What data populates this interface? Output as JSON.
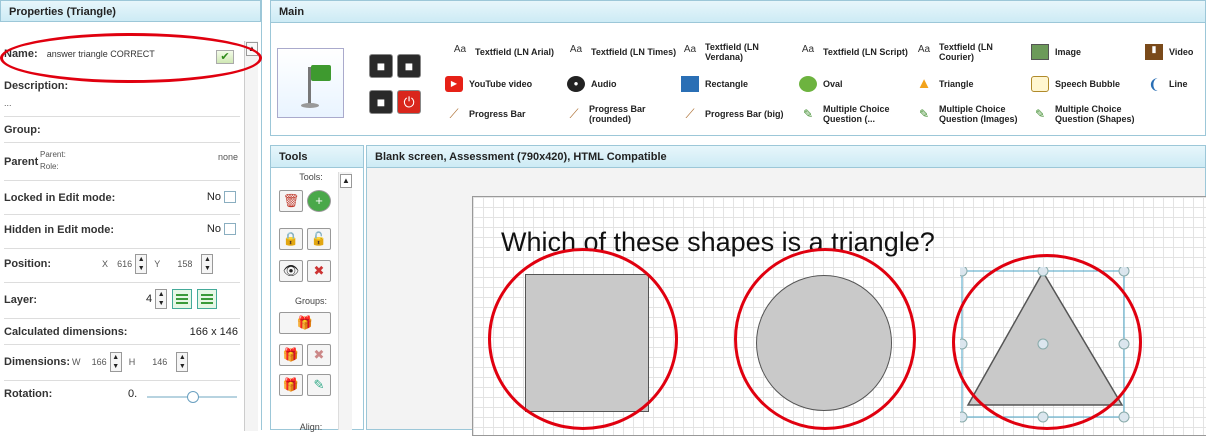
{
  "properties": {
    "title": "Properties (Triangle)",
    "name_label": "Name:",
    "name_value": "answer triangle CORRECT",
    "description_label": "Description:",
    "description_value": "...",
    "group_label": "Group:",
    "parent_label": "Parent",
    "parent_sub1": "Parent:",
    "parent_sub2": "Role:",
    "parent_value": "none",
    "locked_label": "Locked in Edit mode:",
    "locked_value": "No",
    "hidden_label": "Hidden in Edit mode:",
    "hidden_value": "No",
    "position_label": "Position:",
    "x_label": "X",
    "x_value": "616",
    "y_label": "Y",
    "y_value": "158",
    "layer_label": "Layer:",
    "layer_value": "4",
    "calc_dim_label": "Calculated dimensions:",
    "calc_dim_value": "166 x 146",
    "dimensions_label": "Dimensions:",
    "w_label": "W",
    "w_value": "166",
    "h_label": "H",
    "h_value": "146",
    "rotation_label": "Rotation:",
    "rotation_value": "0."
  },
  "main": {
    "title": "Main",
    "tools": [
      {
        "icon": "Aa",
        "label": "Textfield (LN Arial)"
      },
      {
        "icon": "Aa",
        "label": "Textfield (LN Times)"
      },
      {
        "icon": "Aa",
        "label": "Textfield (LN Verdana)"
      },
      {
        "icon": "Aa",
        "label": "Textfield (LN Script)"
      },
      {
        "icon": "Aa",
        "label": "Textfield (LN Courier)"
      },
      {
        "icon": "image-icon",
        "label": "Image"
      },
      {
        "icon": "video-icon",
        "label": "Video"
      },
      {
        "icon": "youtube-icon",
        "label": "YouTube video"
      },
      {
        "icon": "audio-icon",
        "label": "Audio"
      },
      {
        "icon": "rectangle-icon",
        "label": "Rectangle"
      },
      {
        "icon": "oval-icon",
        "label": "Oval"
      },
      {
        "icon": "triangle-icon",
        "label": "Triangle"
      },
      {
        "icon": "speech-bubble-icon",
        "label": "Speech Bubble"
      },
      {
        "icon": "line-icon",
        "label": "Line"
      },
      {
        "icon": "progress-bar-icon",
        "label": "Progress Bar"
      },
      {
        "icon": "progress-bar-rounded-icon",
        "label": "Progress Bar (rounded)"
      },
      {
        "icon": "progress-bar-big-icon",
        "label": "Progress Bar (big)"
      },
      {
        "icon": "pencil-icon",
        "label": "Multiple Choice Question (..."
      },
      {
        "icon": "pencil-icon",
        "label": "Multiple Choice Question (Images)"
      },
      {
        "icon": "pencil-icon",
        "label": "Multiple Choice Question (Shapes)"
      }
    ]
  },
  "tools_panel": {
    "title": "Tools",
    "tools_caption": "Tools:",
    "groups_caption": "Groups:",
    "align_caption": "Align:"
  },
  "canvas": {
    "title": "Blank screen, Assessment (790x420), HTML Compatible",
    "question": "Which of these shapes is a triangle?"
  },
  "colors": {
    "highlight_ring": "#e0000f",
    "panel_header": "#cdebf5",
    "shape_fill": "#c9c9c9"
  }
}
